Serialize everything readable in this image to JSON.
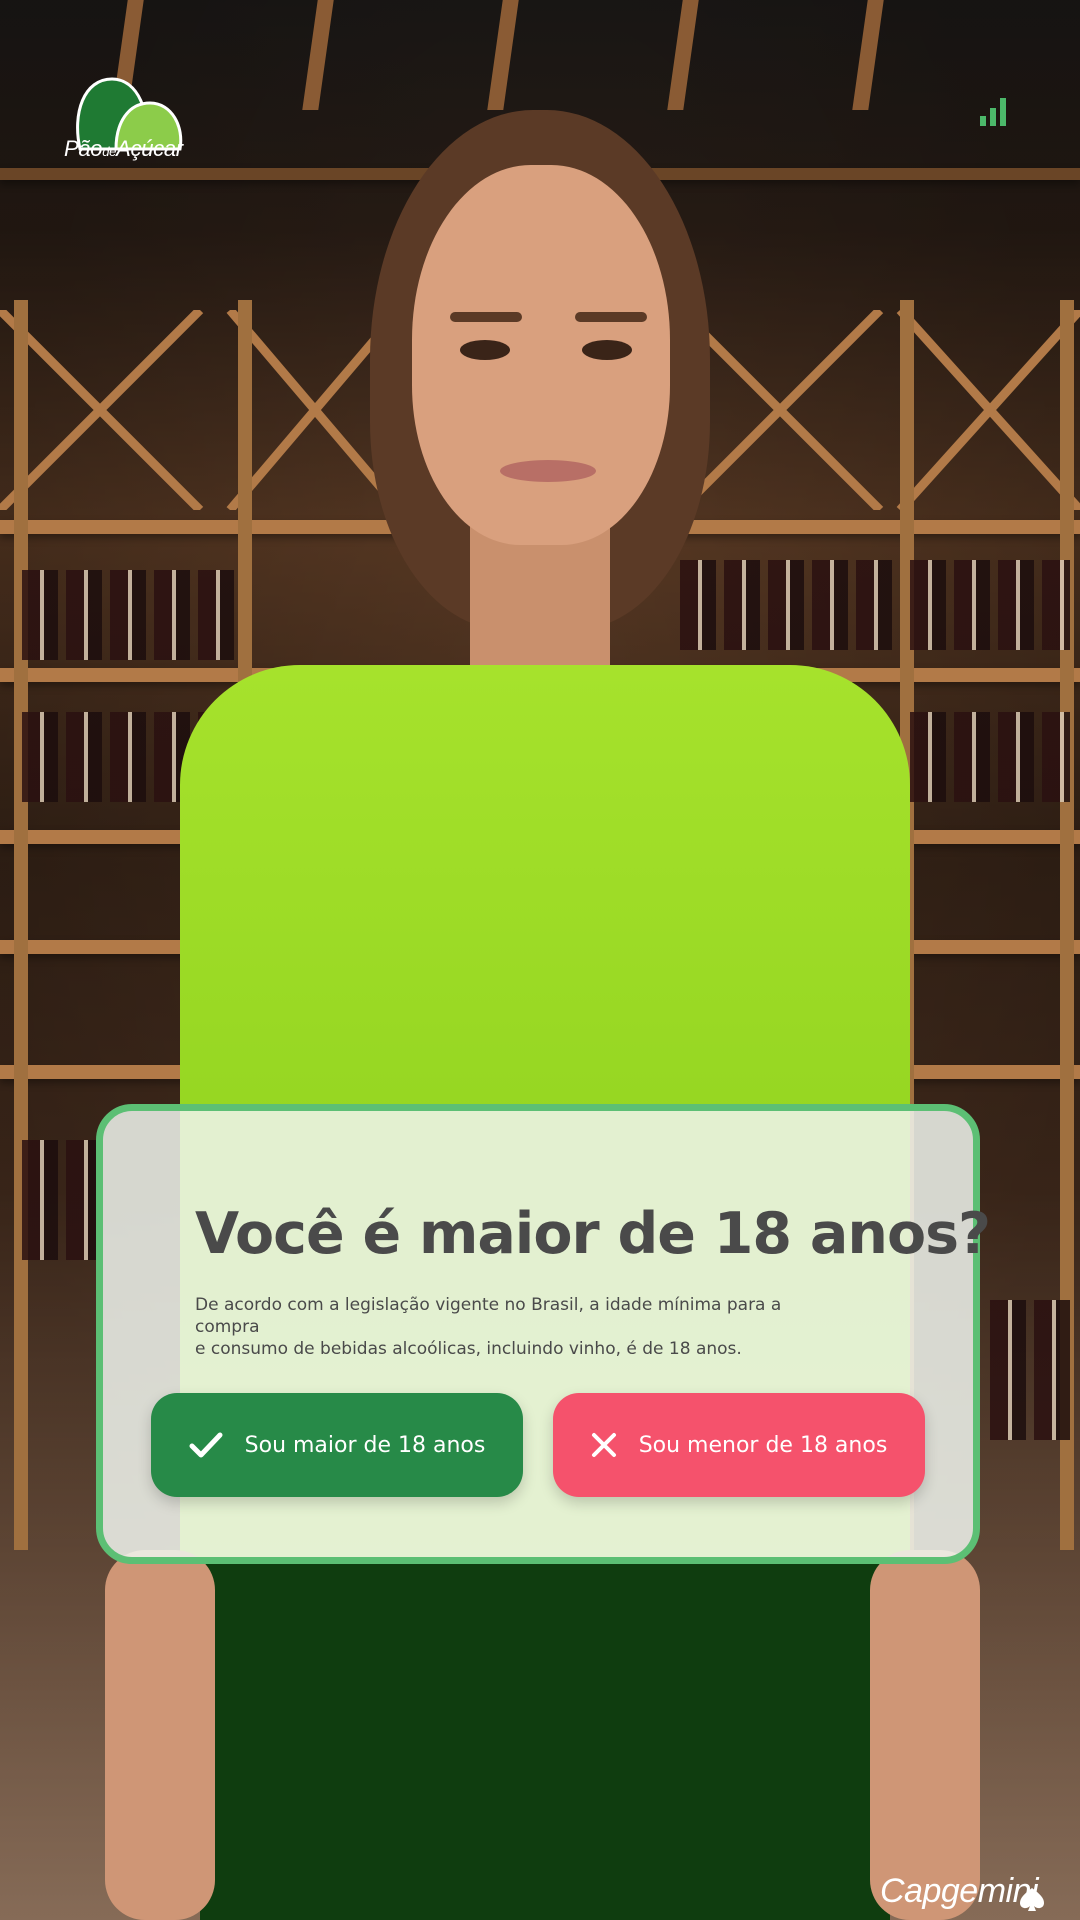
{
  "brand": {
    "logo_text_main": "Pão",
    "logo_text_de": "de",
    "logo_text_end": "Açúcar",
    "footer_logo": "Capgemini"
  },
  "status": {
    "icon": "signal-strength-icon"
  },
  "modal": {
    "title": "Você é maior de 18 anos?",
    "description_line1": "De acordo com a legislação vigente no Brasil, a idade mínima para a compra",
    "description_line2": "e consumo de bebidas alcoólicas, incluindo vinho, é de 18 anos.",
    "confirm_label": "Sou maior de 18 anos",
    "deny_label": "Sou menor de 18 anos"
  },
  "colors": {
    "confirm": "#278a48",
    "deny": "#f5526c",
    "modal_border": "#5cbf74",
    "brand_green": "#1f7a33"
  }
}
